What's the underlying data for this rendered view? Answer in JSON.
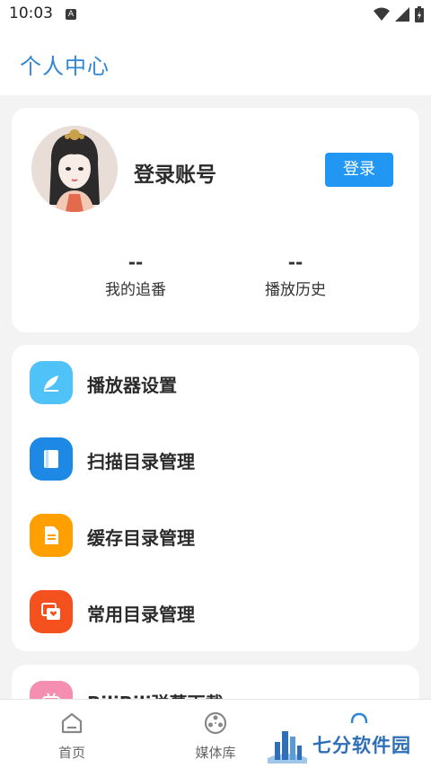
{
  "status_bar": {
    "time": "10:03",
    "notification_badge": "A",
    "icons": [
      "wifi-icon",
      "signal-icon",
      "battery-icon"
    ]
  },
  "header": {
    "title": "个人中心"
  },
  "profile": {
    "account_name": "登录账号",
    "login_button": "登录",
    "stats": [
      {
        "value": "--",
        "label": "我的追番"
      },
      {
        "value": "--",
        "label": "播放历史"
      }
    ]
  },
  "menu": {
    "items": [
      {
        "label": "播放器设置",
        "icon": "feather-icon",
        "color": "#4fc3f7"
      },
      {
        "label": "扫描目录管理",
        "icon": "book-icon",
        "color": "#1e88e5"
      },
      {
        "label": "缓存目录管理",
        "icon": "document-icon",
        "color": "#ffa000"
      },
      {
        "label": "常用目录管理",
        "icon": "folder-heart-icon",
        "color": "#f4511e"
      }
    ]
  },
  "partial_item": {
    "label": "BiliBili弹幕下载",
    "color": "#f48fb1"
  },
  "bottom_nav": {
    "items": [
      {
        "label": "首页",
        "icon": "home-icon"
      },
      {
        "label": "媒体库",
        "icon": "film-reel-icon"
      },
      {
        "label": "",
        "icon": "person-icon"
      }
    ]
  },
  "watermark": {
    "text": "七分软件园"
  },
  "colors": {
    "accent": "#2196f3",
    "title": "#2f86d6",
    "background": "#f3f3f3"
  }
}
